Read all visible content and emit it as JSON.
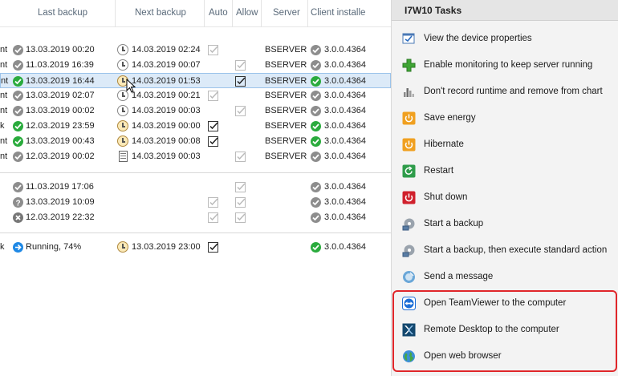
{
  "grid": {
    "headers": {
      "last_backup": "Last backup",
      "next_backup": "Next backup",
      "auto": "Auto",
      "allow": "Allow",
      "server": "Server",
      "client_installed": "Client installe"
    },
    "rows": [
      {
        "status": "nt",
        "last": "13.03.2019 00:20",
        "next": "14.03.2019 02:24",
        "server": "BSERVER",
        "client": "3.0.0.4364"
      },
      {
        "status": "nt",
        "last": "11.03.2019 16:39",
        "next": "14.03.2019 00:07",
        "server": "BSERVER",
        "client": "3.0.0.4364"
      },
      {
        "status": "nt",
        "last": "13.03.2019 16:44",
        "next": "14.03.2019 01:53",
        "server": "BSERVER",
        "client": "3.0.0.4364"
      },
      {
        "status": "nt",
        "last": "13.03.2019 02:07",
        "next": "14.03.2019 00:21",
        "server": "BSERVER",
        "client": "3.0.0.4364"
      },
      {
        "status": "nt",
        "last": "13.03.2019 00:02",
        "next": "14.03.2019 00:03",
        "server": "BSERVER",
        "client": "3.0.0.4364"
      },
      {
        "status": "k",
        "last": "12.03.2019 23:59",
        "next": "14.03.2019 00:00",
        "server": "BSERVER",
        "client": "3.0.0.4364"
      },
      {
        "status": "nt",
        "last": "13.03.2019 00:43",
        "next": "14.03.2019 00:08",
        "server": "BSERVER",
        "client": "3.0.0.4364"
      },
      {
        "status": "nt",
        "last": "12.03.2019 00:02",
        "next": "14.03.2019 00:03",
        "server": "BSERVER",
        "client": "3.0.0.4364"
      },
      {
        "status": "",
        "last": "11.03.2019 17:06",
        "next": "",
        "server": "",
        "client": "3.0.0.4364"
      },
      {
        "status": "",
        "last": "13.03.2019 10:09",
        "next": "",
        "server": "",
        "client": "3.0.0.4364"
      },
      {
        "status": "",
        "last": "12.03.2019 22:32",
        "next": "",
        "server": "",
        "client": "3.0.0.4364"
      },
      {
        "status": "k",
        "last": "Running, 74%",
        "next": "13.03.2019 23:00",
        "server": "",
        "client": "3.0.0.4364"
      }
    ]
  },
  "pane": {
    "title": "I7W10 Tasks",
    "tasks": [
      {
        "label": "View the device properties",
        "icon": "properties-icon"
      },
      {
        "label": "Enable monitoring to keep server running",
        "icon": "plus-icon"
      },
      {
        "label": "Don't record runtime and remove from chart",
        "icon": "chart-icon"
      },
      {
        "label": "Save energy",
        "icon": "power-orange-icon"
      },
      {
        "label": "Hibernate",
        "icon": "power-orange-icon"
      },
      {
        "label": "Restart",
        "icon": "restart-icon"
      },
      {
        "label": "Shut down",
        "icon": "shutdown-icon"
      },
      {
        "label": "Start a backup",
        "icon": "backup-icon"
      },
      {
        "label": "Start a backup, then execute standard action",
        "icon": "backup-icon"
      },
      {
        "label": "Send a message",
        "icon": "message-icon"
      },
      {
        "label": "Open TeamViewer to the computer",
        "icon": "teamviewer-icon"
      },
      {
        "label": "Remote Desktop to the computer",
        "icon": "remote-desktop-icon"
      },
      {
        "label": "Open web browser",
        "icon": "globe-icon"
      }
    ]
  },
  "colors": {
    "accent_green": "#2aab3d",
    "selection_bg": "#dceaf8",
    "highlight_border": "#e0262a"
  }
}
